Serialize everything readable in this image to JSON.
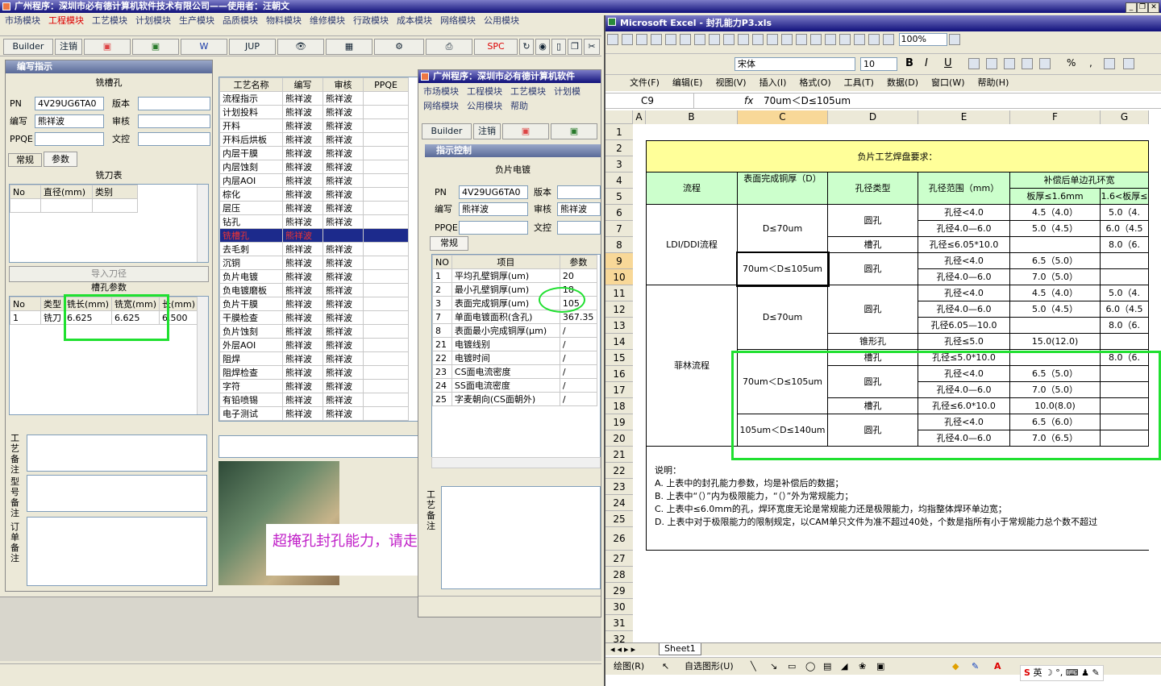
{
  "main": {
    "title": "广州程序：深圳市必有德计算机软件技术有限公司——使用者：汪朝文",
    "menu": [
      "市场模块",
      "工程模块",
      "工艺模块",
      "计划模块",
      "生产模块",
      "品质模块",
      "物料模块",
      "维修模块",
      "行政模块",
      "成本模块",
      "网络模块",
      "公用模块"
    ],
    "toolbar": {
      "builder": "Builder",
      "logout": "注销",
      "jup": "JUP",
      "spc": "SPC"
    }
  },
  "compose": {
    "title": "编写指示",
    "process": "铣槽孔",
    "pn_label": "PN",
    "pn": "4V29UG6TA0",
    "writer_label": "编写",
    "writer": "熊祥波",
    "ppqe_label": "PPQE",
    "version_label": "版本",
    "review_label": "审核",
    "doc_label": "文控",
    "tabs": [
      "常规",
      "参数"
    ],
    "cutter_title": "铣刀表",
    "cutter_cols": [
      "No",
      "直径(mm)",
      "类别"
    ],
    "import_btn": "导入刀径",
    "slot_title": "槽孔参数",
    "slot_cols": [
      "No",
      "类型",
      "铣长(mm)",
      "铣宽(mm)",
      "长(mm)"
    ],
    "slot_rows": [
      [
        "1",
        "铣刀",
        "6.625",
        "6.625",
        "6.500"
      ]
    ],
    "remark_labels": [
      "工艺备注",
      "型号备注",
      "订单备注"
    ]
  },
  "process_list": {
    "cols": [
      "工艺名称",
      "编写",
      "审核",
      "PPQE"
    ],
    "rows": [
      [
        "流程指示",
        "熊祥波",
        "熊祥波"
      ],
      [
        "计划投料",
        "熊祥波",
        "熊祥波"
      ],
      [
        "开料",
        "熊祥波",
        "熊祥波"
      ],
      [
        "开料后烘板",
        "熊祥波",
        "熊祥波"
      ],
      [
        "内层干膜",
        "熊祥波",
        "熊祥波"
      ],
      [
        "内层蚀刻",
        "熊祥波",
        "熊祥波"
      ],
      [
        "内层AOI",
        "熊祥波",
        "熊祥波"
      ],
      [
        "棕化",
        "熊祥波",
        "熊祥波"
      ],
      [
        "层压",
        "熊祥波",
        "熊祥波"
      ],
      [
        "钻孔",
        "熊祥波",
        "熊祥波"
      ],
      [
        "铣槽孔",
        "熊祥波",
        ""
      ],
      [
        "去毛刺",
        "熊祥波",
        "熊祥波"
      ],
      [
        "沉铜",
        "熊祥波",
        "熊祥波"
      ],
      [
        "负片电镀",
        "熊祥波",
        "熊祥波"
      ],
      [
        "负电镀磨板",
        "熊祥波",
        "熊祥波"
      ],
      [
        "负片干膜",
        "熊祥波",
        "熊祥波"
      ],
      [
        "干膜检查",
        "熊祥波",
        "熊祥波"
      ],
      [
        "负片蚀刻",
        "熊祥波",
        "熊祥波"
      ],
      [
        "外层AOI",
        "熊祥波",
        "熊祥波"
      ],
      [
        "阻焊",
        "熊祥波",
        "熊祥波"
      ],
      [
        "阻焊检查",
        "熊祥波",
        "熊祥波"
      ],
      [
        "字符",
        "熊祥波",
        "熊祥波"
      ],
      [
        "有铅喷锡",
        "熊祥波",
        "熊祥波"
      ],
      [
        "电子测试",
        "熊祥波",
        "熊祥波"
      ]
    ],
    "selected": 10,
    "annotation": "超掩孔封孔能力，请走图镀！"
  },
  "second": {
    "title": "广州程序：深圳市必有德计算机软件",
    "menu1": [
      "市场模块",
      "工程模块",
      "工艺模块",
      "计划模"
    ],
    "menu2": [
      "网络模块",
      "公用模块",
      "帮助"
    ],
    "builder": "Builder",
    "logout": "注销",
    "panel_title": "指示控制",
    "process": "负片电镀",
    "pn_label": "PN",
    "pn": "4V29UG6TA0",
    "writer_label": "编写",
    "writer": "熊祥波",
    "review_label": "审核",
    "reviewer": "熊祥波",
    "version_label": "版本",
    "doc_label": "文控",
    "ppqe_label": "PPQE",
    "tab": "常规",
    "cols": [
      "NO",
      "项目",
      "参数"
    ],
    "rows": [
      [
        "1",
        "平均孔壁铜厚(um)",
        "20"
      ],
      [
        "2",
        "最小孔壁铜厚(um)",
        "18"
      ],
      [
        "3",
        "表面完成铜厚(um)",
        "105"
      ],
      [
        "7",
        "单面电镀面积(含孔)",
        "367.35"
      ],
      [
        "8",
        "表面最小完成铜厚(μm)",
        "/"
      ],
      [
        "21",
        "电镀线别",
        "/"
      ],
      [
        "22",
        "电镀时间",
        "/"
      ],
      [
        "23",
        "CS面电流密度",
        "/"
      ],
      [
        "24",
        "SS面电流密度",
        "/"
      ],
      [
        "25",
        "字麦朝向(CS面朝外)",
        "/"
      ]
    ],
    "remark_label": "工艺备注"
  },
  "excel": {
    "title": "Microsoft Excel - 封孔能力P3.xls",
    "zoom": "100%",
    "font": "宋体",
    "size": "10",
    "menu": [
      "文件(F)",
      "编辑(E)",
      "视图(V)",
      "插入(I)",
      "格式(O)",
      "工具(T)",
      "数据(D)",
      "窗口(W)",
      "帮助(H)"
    ],
    "cell_ref": "C9",
    "formula": "70um＜D≤105um",
    "cols": [
      "A",
      "B",
      "C",
      "D",
      "E",
      "F",
      "G"
    ],
    "rows": [
      "1",
      "2",
      "3",
      "4",
      "5",
      "6",
      "7",
      "8",
      "9",
      "10",
      "11",
      "12",
      "13",
      "14",
      "15",
      "16",
      "17",
      "18",
      "19",
      "20",
      "21",
      "22",
      "23",
      "24",
      "25",
      "26",
      "27",
      "28",
      "29",
      "30",
      "31",
      "32"
    ],
    "table_title": "负片工艺焊盘要求：",
    "h_flow": "流程",
    "h_thick": "表面完成铜厚（D）",
    "h_type": "孔径类型",
    "h_range": "孔径范围（mm）",
    "h_ring": "补偿后单边孔环宽",
    "h_f": "板厚≤1.6mm",
    "h_g": "1.6<板厚≤",
    "flow1": "LDI/DDI流程",
    "flow2": "菲林流程",
    "t1": "D≤70um",
    "t2": "70um＜D≤105um",
    "t3": "D≤70um",
    "t4": "70um＜D≤105um",
    "t5": "105um＜D≤140um",
    "ty_round": "圆孔",
    "ty_slot": "槽孔",
    "ty_cone": "锥形孔",
    "r": [
      "孔径<4.0",
      "孔径4.0—6.0",
      "孔径≤6.05*10.0",
      "孔径<4.0",
      "孔径4.0—6.0",
      "孔径<4.0",
      "孔径4.0—6.0",
      "孔径6.05—10.0",
      "孔径≤5.0",
      "孔径≤5.0*10.0",
      "孔径<4.0",
      "孔径4.0—6.0",
      "孔径≤6.0*10.0",
      "孔径<4.0",
      "孔径4.0—6.0"
    ],
    "f": [
      "4.5（4.0）",
      "5.0（4.5）",
      "",
      "6.5（5.0）",
      "7.0（5.0）",
      "4.5（4.0）",
      "5.0（4.5）",
      "",
      "15.0(12.0)",
      "",
      "6.5（5.0）",
      "7.0（5.0）",
      "10.0(8.0)",
      "6.5（6.0）",
      "7.0（6.5）"
    ],
    "g": [
      "5.0（4.",
      "6.0（4.5",
      "8.0（6.",
      "",
      "",
      "5.0（4.",
      "6.0（4.5",
      "8.0（6.",
      "",
      "8.0（6.",
      "",
      "",
      "",
      "",
      ""
    ],
    "notes": [
      "说明：",
      "A. 上表中的封孔能力参数，均是补偿后的数据；",
      "B. 上表中“（）”内为极限能力，“（）”外为常规能力；",
      "C. 上表中≤6.0mm的孔，焊环宽度无论是常规能力还是极限能力，均指整体焊环单边宽；",
      "D. 上表中对于极限能力的限制规定，以CAM单只文件为准不超过40处，个数是指所有小于常规能力总个数不超过"
    ],
    "sheet": "Sheet1",
    "draw": "绘图(R)",
    "autoshape": "自选图形(U)",
    "ime": "英"
  }
}
